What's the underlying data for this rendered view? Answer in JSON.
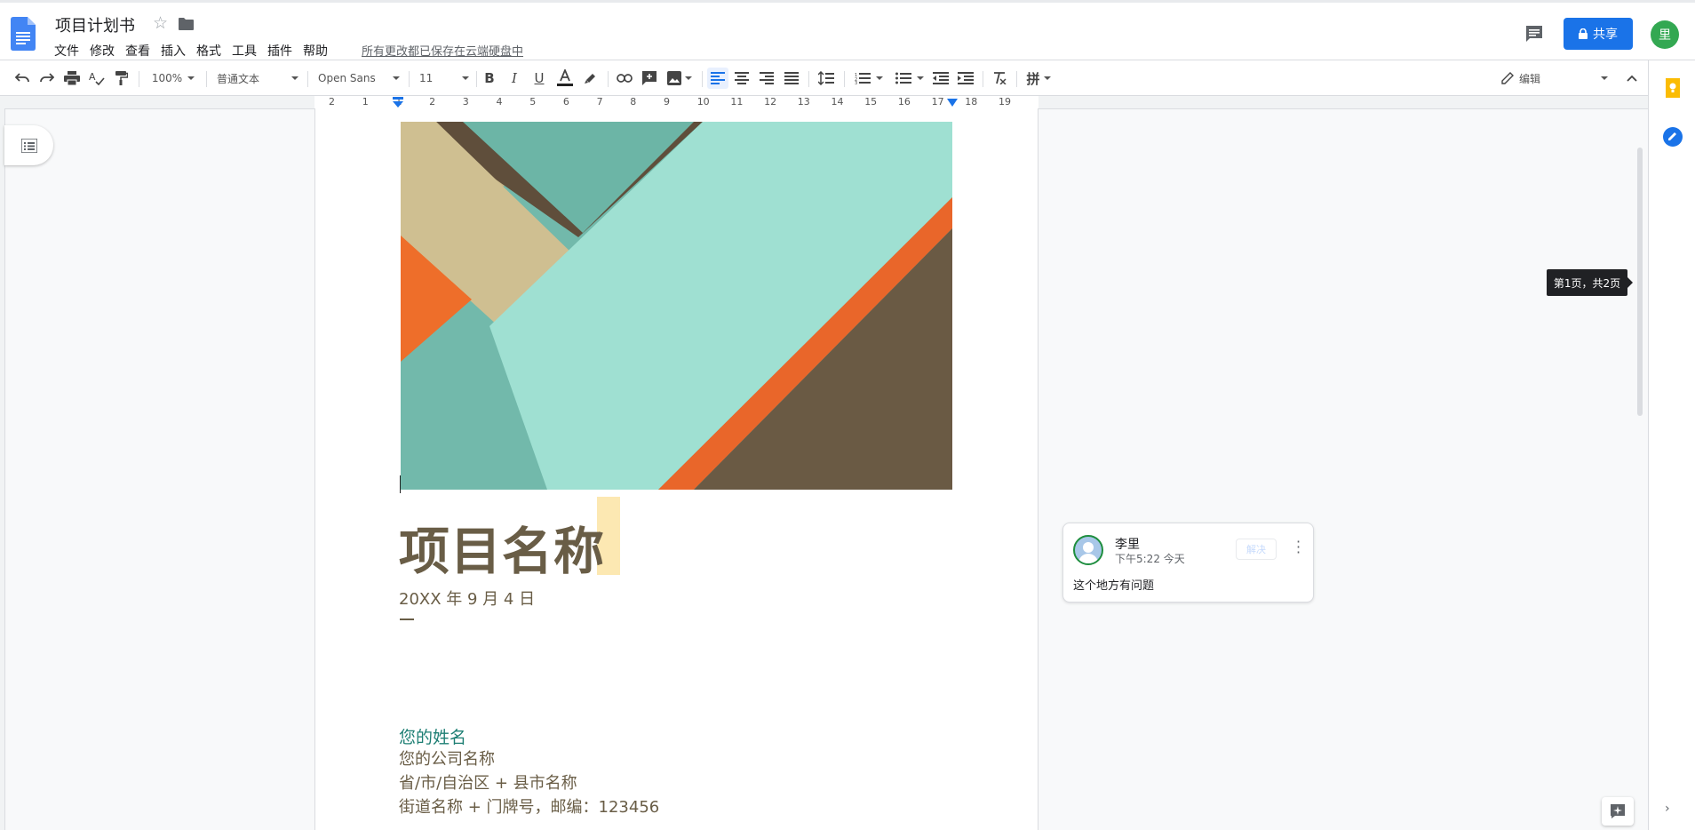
{
  "header": {
    "doc_title": "项目计划书",
    "menu": [
      "文件",
      "修改",
      "查看",
      "插入",
      "格式",
      "工具",
      "插件",
      "帮助"
    ],
    "save_status": "所有更改都已保存在云端硬盘中",
    "share_label": "共享",
    "avatar_initial": "里"
  },
  "toolbar": {
    "zoom": "100%",
    "style": "普通文本",
    "font": "Open Sans",
    "size": "11",
    "mode": "编辑",
    "icons": [
      "undo-icon",
      "redo-icon",
      "print-icon",
      "spellcheck-icon",
      "paint-format-icon",
      "bold-icon",
      "italic-icon",
      "underline-icon",
      "text-color-icon",
      "highlight-icon",
      "link-icon",
      "comment-add-icon",
      "image-icon",
      "align-left-icon",
      "align-center-icon",
      "align-right-icon",
      "justify-icon",
      "line-spacing-icon",
      "numbered-list-icon",
      "bulleted-list-icon",
      "decrease-indent-icon",
      "increase-indent-icon",
      "clear-format-icon",
      "input-tools-icon",
      "pencil-icon",
      "collapse-icon"
    ]
  },
  "ruler": {
    "labels": [
      "2",
      "1",
      "1",
      "2",
      "3",
      "4",
      "5",
      "6",
      "7",
      "8",
      "9",
      "10",
      "11",
      "12",
      "13",
      "14",
      "15",
      "16",
      "17",
      "18",
      "19"
    ]
  },
  "document": {
    "title": "项目名称",
    "date": "20XX 年 9 月 4 日",
    "name": "您的姓名",
    "company": "您的公司名称",
    "region": "省/市/自治区 + 县市名称",
    "street": "街道名称 + 门牌号，邮编：123456"
  },
  "comment": {
    "author": "李里",
    "time": "下午5:22 今天",
    "resolve_label": "解决",
    "text": "这个地方有问题"
  },
  "page_tooltip": "第1页，共2页",
  "colors": {
    "accent": "#1a73e8",
    "title_brown": "#695d46",
    "teal": "#1e7f74",
    "avatar_green": "#33a852"
  }
}
